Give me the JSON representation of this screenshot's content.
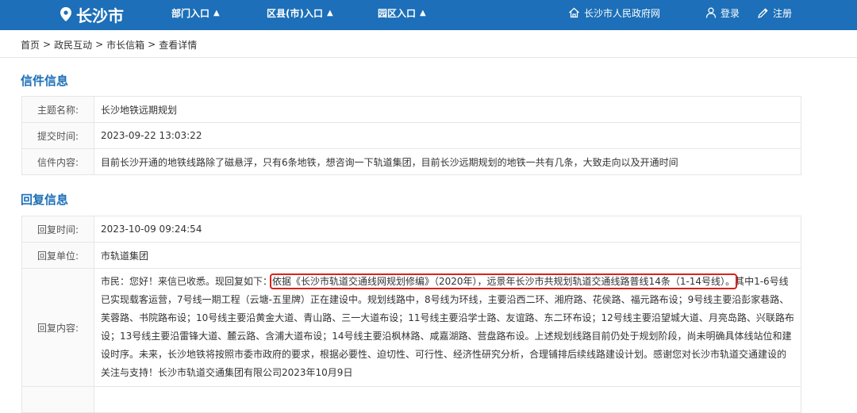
{
  "header": {
    "city": "长沙市",
    "nav": [
      {
        "label": "部门入口"
      },
      {
        "label": "区县(市)入口"
      },
      {
        "label": "园区入口"
      }
    ],
    "nav_arrow": "▲",
    "gov_link": "长沙市人民政府网",
    "login": "登录",
    "register": "注册",
    "bg_color": "#1c6fb8"
  },
  "breadcrumb": {
    "items": [
      "首页",
      "政民互动",
      "市长信箱",
      "查看详情"
    ],
    "separator": ">"
  },
  "letter": {
    "section_title": "信件信息",
    "rows": [
      {
        "label": "主题名称:",
        "value": "长沙地铁远期规划"
      },
      {
        "label": "提交时间:",
        "value": "2023-09-22 13:03:22"
      },
      {
        "label": "信件内容:",
        "value": "目前长沙开通的地铁线路除了磁悬浮，只有6条地铁，想咨询一下轨道集团，目前长沙远期规划的地铁一共有几条，大致走向以及开通时间"
      }
    ]
  },
  "reply": {
    "section_title": "回复信息",
    "time_label": "回复时间:",
    "time_value": "2023-10-09 09:24:54",
    "unit_label": "回复单位:",
    "unit_value": "市轨道集团",
    "content_label": "回复内容:",
    "content_before": "市民：您好！来信已收悉。现回复如下：",
    "content_highlight": "依据《长沙市轨道交通线网规划修编》（2020年），远景年长沙市共规划轨道交通线路普线14条（1-14号线）。",
    "content_after": "其中1-6号线已实现载客运营，7号线一期工程（云塘-五里牌）正在建设中。规划线路中，8号线为环线，主要沿西二环、湘府路、花侯路、福元路布设；9号线主要沿彭家巷路、芙蓉路、书院路布设；10号线主要沿黄金大道、青山路、三一大道布设；11号线主要沿学士路、友谊路、东二环布设；12号线主要沿望城大道、月亮岛路、兴联路布设；13号线主要沿雷锋大道、麓云路、含浦大道布设；14号线主要沿枫林路、咸嘉湖路、营盘路布设。上述规划线路目前仍处于规划阶段，尚未明确具体线站位和建设时序。未来，长沙地铁将按照市委市政府的要求，根据必要性、迫切性、可行性、经济性研究分析，合理铺排后续线路建设计划。感谢您对长沙市轨道交通建设的关注与支持！长沙市轨道交通集团有限公司2023年10月9日",
    "highlight_color": "#d9211b"
  }
}
